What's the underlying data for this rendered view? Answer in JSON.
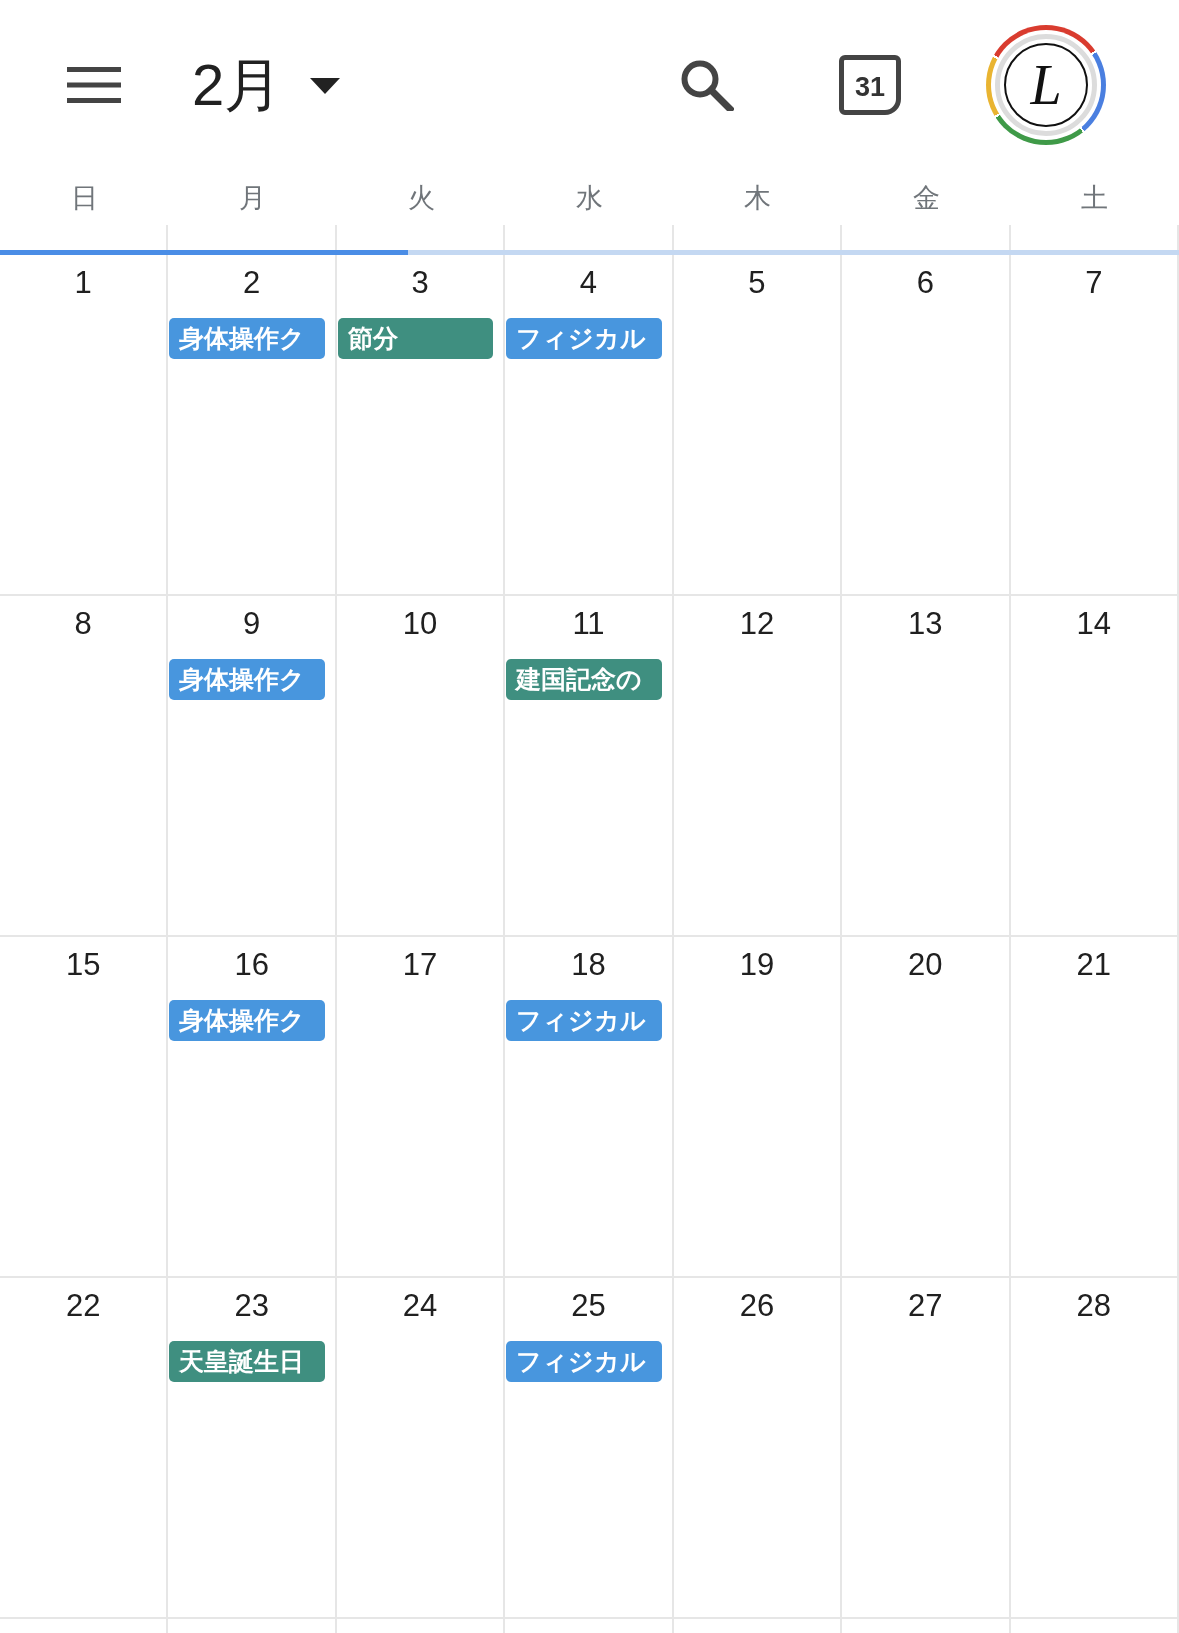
{
  "header": {
    "month_title": "2月",
    "today_button": {
      "label": "31"
    },
    "avatar": {
      "letter": "L"
    }
  },
  "weekdays": [
    "日",
    "月",
    "火",
    "水",
    "木",
    "金",
    "土"
  ],
  "loading_bar": {
    "level": 0.346
  },
  "weeks": [
    {
      "days": [
        {
          "date": "1"
        },
        {
          "date": "2",
          "events": [
            {
              "title": "身体操作ク",
              "color": "#4896de"
            }
          ]
        },
        {
          "date": "3",
          "events": [
            {
              "title": "節分",
              "color": "#3f8f80"
            }
          ]
        },
        {
          "date": "4",
          "events": [
            {
              "title": "フィジカル",
              "color": "#4896de"
            }
          ]
        },
        {
          "date": "5"
        },
        {
          "date": "6"
        },
        {
          "date": "7"
        }
      ]
    },
    {
      "days": [
        {
          "date": "8"
        },
        {
          "date": "9",
          "events": [
            {
              "title": "身体操作ク",
              "color": "#4896de"
            }
          ]
        },
        {
          "date": "10"
        },
        {
          "date": "11",
          "events": [
            {
              "title": "建国記念の",
              "color": "#3f8f80"
            }
          ]
        },
        {
          "date": "12"
        },
        {
          "date": "13"
        },
        {
          "date": "14"
        }
      ]
    },
    {
      "days": [
        {
          "date": "15"
        },
        {
          "date": "16",
          "events": [
            {
              "title": "身体操作ク",
              "color": "#4896de"
            }
          ]
        },
        {
          "date": "17"
        },
        {
          "date": "18",
          "events": [
            {
              "title": "フィジカル",
              "color": "#4896de"
            }
          ]
        },
        {
          "date": "19"
        },
        {
          "date": "20"
        },
        {
          "date": "21"
        }
      ]
    },
    {
      "days": [
        {
          "date": "22"
        },
        {
          "date": "23",
          "events": [
            {
              "title": "天皇誕生日",
              "color": "#3f8f80"
            }
          ]
        },
        {
          "date": "24"
        },
        {
          "date": "25",
          "events": [
            {
              "title": "フィジカル",
              "color": "#4896de"
            }
          ]
        },
        {
          "date": "26"
        },
        {
          "date": "27"
        },
        {
          "date": "28"
        }
      ]
    }
  ]
}
